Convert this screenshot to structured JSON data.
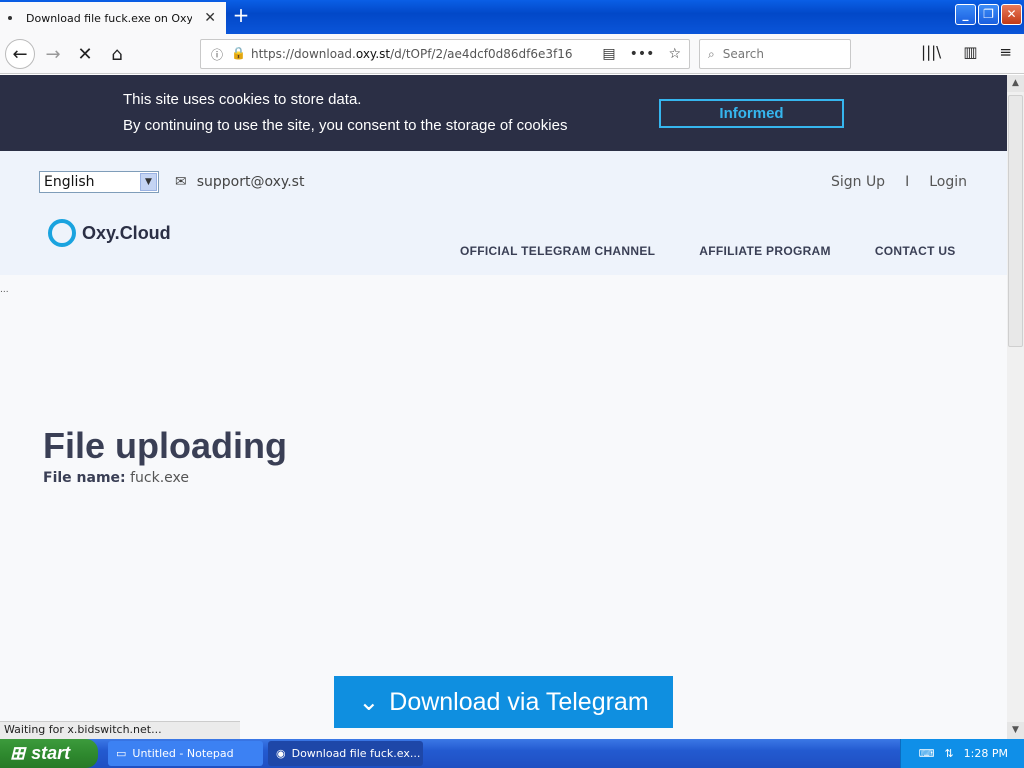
{
  "browser": {
    "tab_title": "Download file fuck.exe on Oxy.Cloud",
    "url_prefix": "https://download.",
    "url_domain": "oxy.st",
    "url_path": "/d/tOPf/2/ae4dcf0d86df6e3f16",
    "search_placeholder": "Search"
  },
  "cookie_banner": {
    "line1": "This site uses cookies to store data.",
    "line2": "By continuing to use the site, you consent to the storage of cookies",
    "button": "Informed"
  },
  "header": {
    "language": "English",
    "email": "support@oxy.st",
    "signup": "Sign Up",
    "separator": "I",
    "login": "Login",
    "logo": "Oxy.Cloud",
    "menu": [
      "OFFICIAL TELEGRAM CHANNEL",
      "AFFILIATE PROGRAM",
      "CONTACT US"
    ]
  },
  "main": {
    "ellipsis": "...",
    "heading": "File uploading",
    "file_label": "File name:",
    "file_name": "fuck.exe",
    "download_button": "Download via Telegram"
  },
  "status": "Waiting for x.bidswitch.net...",
  "taskbar": {
    "start": "start",
    "tasks": [
      "Untitled - Notepad",
      "Download file fuck.ex..."
    ],
    "clock": "1:28 PM"
  },
  "colors": {
    "cookie_bg": "#2b2f45",
    "accent": "#36b6ee",
    "download_button": "#0f8fe0"
  }
}
